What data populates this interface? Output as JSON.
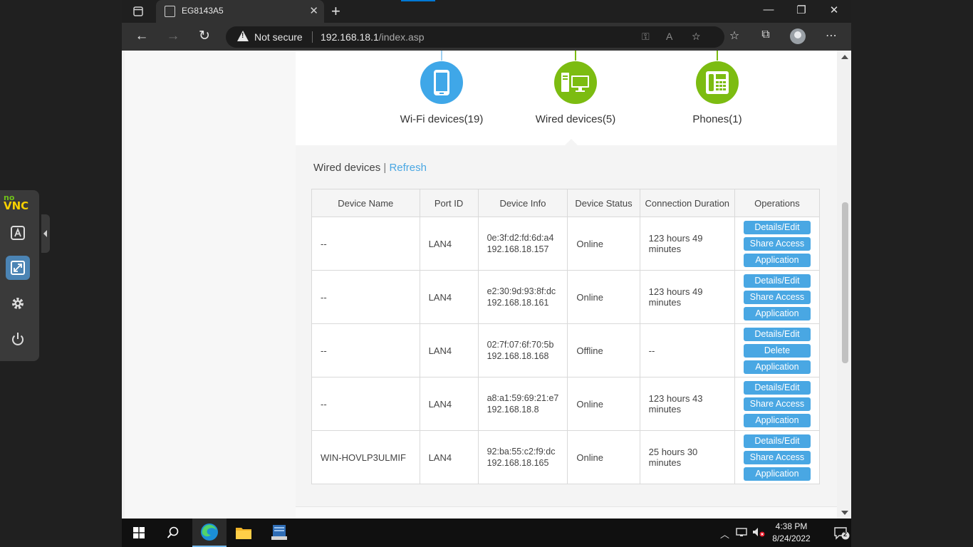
{
  "browser": {
    "tab_title": "EG8143A5",
    "not_secure": "Not secure",
    "url_host": "192.168.18.1",
    "url_path": "/index.asp"
  },
  "topology": {
    "nodes": [
      {
        "label": "Wi-Fi devices(19)",
        "color": "#3fa7e8",
        "icon": "phone-icon"
      },
      {
        "label": "Wired devices(5)",
        "color": "#7cbc11",
        "icon": "computer-icon"
      },
      {
        "label": "Phones(1)",
        "color": "#7cbc11",
        "icon": "telephone-icon"
      }
    ]
  },
  "section": {
    "title": "Wired devices",
    "separator": "|",
    "refresh": "Refresh"
  },
  "table": {
    "headers": [
      "Device Name",
      "Port ID",
      "Device Info",
      "Device Status",
      "Connection Duration",
      "Operations"
    ],
    "rows": [
      {
        "name": "--",
        "port": "LAN4",
        "mac": "0e:3f:d2:fd:6d:a4",
        "ip": "192.168.18.157",
        "status": "Online",
        "duration": "123 hours 49 minutes",
        "ops": [
          "Details/Edit",
          "Share Access",
          "Application"
        ]
      },
      {
        "name": "--",
        "port": "LAN4",
        "mac": "e2:30:9d:93:8f:dc",
        "ip": "192.168.18.161",
        "status": "Online",
        "duration": "123 hours 49 minutes",
        "ops": [
          "Details/Edit",
          "Share Access",
          "Application"
        ]
      },
      {
        "name": "--",
        "port": "LAN4",
        "mac": "02:7f:07:6f:70:5b",
        "ip": "192.168.18.168",
        "status": "Offline",
        "duration": "--",
        "ops": [
          "Details/Edit",
          "Delete",
          "Application"
        ]
      },
      {
        "name": "--",
        "port": "LAN4",
        "mac": "a8:a1:59:69:21:e7",
        "ip": "192.168.18.8",
        "status": "Online",
        "duration": "123 hours 43 minutes",
        "ops": [
          "Details/Edit",
          "Share Access",
          "Application"
        ]
      },
      {
        "name": "WIN-HOVLP3ULMIF",
        "port": "LAN4",
        "mac": "92:ba:55:c2:f9:dc",
        "ip": "192.168.18.165",
        "status": "Online",
        "duration": "25 hours 30 minutes",
        "ops": [
          "Details/Edit",
          "Share Access",
          "Application"
        ]
      }
    ]
  },
  "novnc": {
    "logo_no": "no",
    "logo_vnc": "VNC"
  },
  "taskbar": {
    "time": "4:38 PM",
    "date": "8/24/2022",
    "notifications": "2"
  },
  "colors": {
    "accent": "#49a7e3",
    "wifi": "#3fa7e8",
    "wired": "#7cbc11"
  }
}
